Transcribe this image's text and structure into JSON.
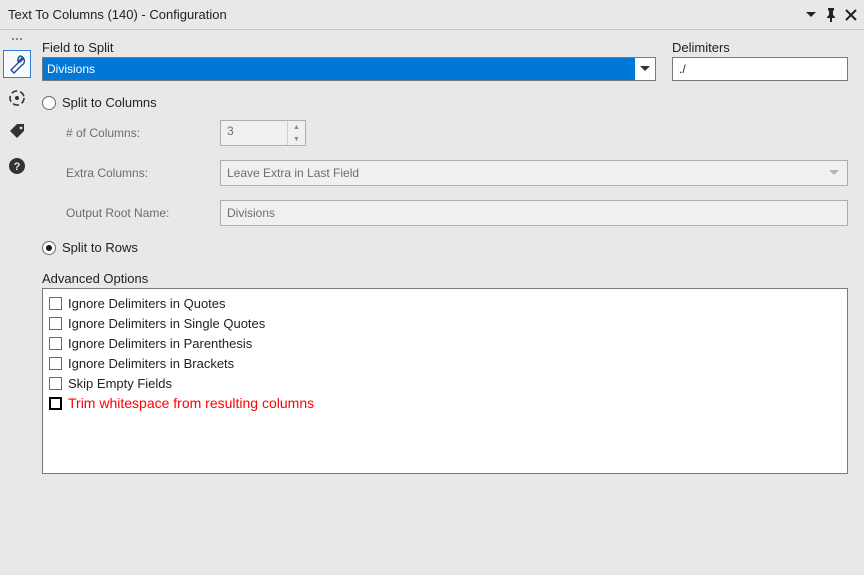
{
  "title": "Text To Columns (140) - Configuration",
  "fieldToSplit": {
    "label": "Field to Split",
    "value": "Divisions"
  },
  "delimiters": {
    "label": "Delimiters",
    "value": "./"
  },
  "splitToColumns": {
    "label": "Split to Columns",
    "selected": false,
    "numColumns": {
      "label": "# of Columns:",
      "value": "3"
    },
    "extraColumns": {
      "label": "Extra Columns:",
      "value": "Leave Extra in Last Field"
    },
    "outputRoot": {
      "label": "Output Root Name:",
      "value": "Divisions"
    }
  },
  "splitToRows": {
    "label": "Split to Rows",
    "selected": true
  },
  "advanced": {
    "label": "Advanced Options",
    "opts": [
      "Ignore Delimiters in Quotes",
      "Ignore Delimiters in Single Quotes",
      "Ignore Delimiters in Parenthesis",
      "Ignore Delimiters in Brackets",
      "Skip Empty Fields"
    ],
    "highlighted": "Trim whitespace from resulting columns"
  }
}
